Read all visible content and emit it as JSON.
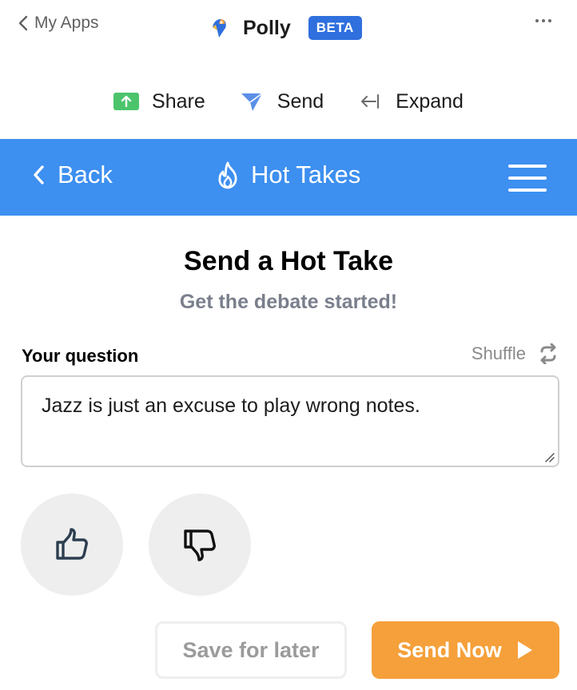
{
  "topbar": {
    "back_label": "My Apps",
    "app_name": "Polly",
    "badge": "BETA"
  },
  "actions": {
    "share": "Share",
    "send": "Send",
    "expand": "Expand"
  },
  "header": {
    "back_label": "Back",
    "title": "Hot Takes"
  },
  "content": {
    "title": "Send a Hot Take",
    "subtitle": "Get the debate started!",
    "question_label": "Your question",
    "shuffle_label": "Shuffle",
    "question_value": "Jazz is just an excuse to play wrong notes."
  },
  "buttons": {
    "save": "Save for later",
    "send_now": "Send Now"
  },
  "colors": {
    "accent_blue": "#3d8ff0",
    "badge_blue": "#2f6fde",
    "send_orange": "#f5a03a",
    "share_green": "#4cc46b"
  },
  "icons": [
    "chevron-left-icon",
    "polly-logo",
    "more-icon",
    "share-icon",
    "send-icon",
    "expand-icon",
    "flame-icon",
    "menu-icon",
    "shuffle-icon",
    "thumbs-up-icon",
    "thumbs-down-icon",
    "play-icon"
  ]
}
